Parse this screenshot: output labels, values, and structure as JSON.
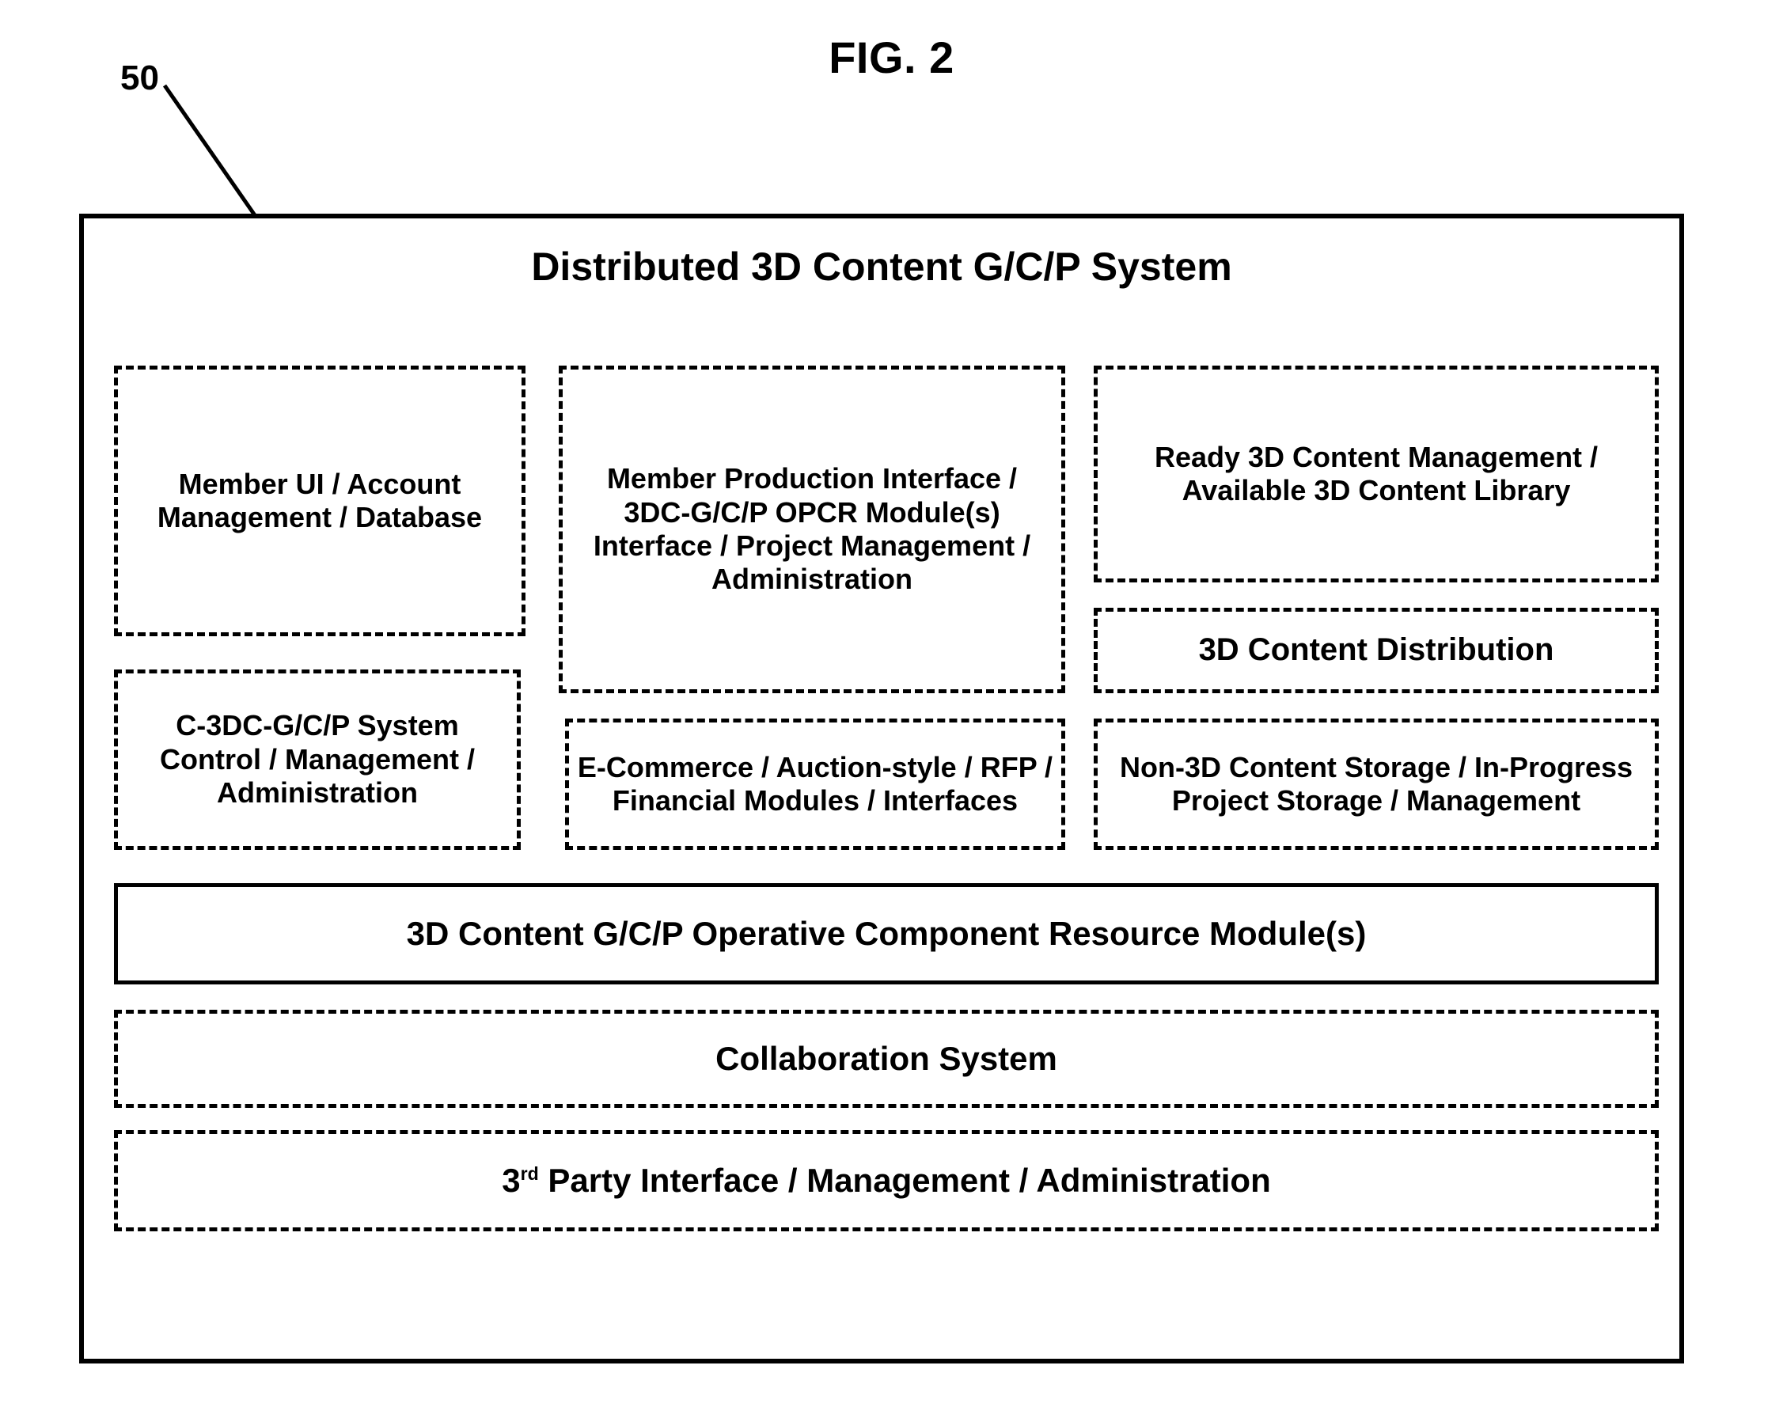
{
  "figure": {
    "label": "FIG. 2",
    "reference_numeral": "50"
  },
  "system": {
    "title": "Distributed 3D Content G/C/P System",
    "border_color": "#000000",
    "background_color": "#ffffff",
    "modules": {
      "member_ui": "Member UI / Account Management / Database",
      "system_control": "C-3DC-G/C/P System Control / Management / Administration",
      "member_production": "Member Production Interface / 3DC-G/C/P OPCR Module(s) Interface / Project Management / Administration",
      "ecommerce": "E-Commerce / Auction-style / RFP / Financial Modules / Interfaces",
      "ready_3d_content": "Ready 3D Content Management / Available 3D Content Library",
      "content_distribution": "3D Content Distribution",
      "non_3d_storage": "Non-3D Content Storage / In-Progress Project Storage / Management",
      "opcr_modules": "3D Content G/C/P Operative Component Resource Module(s)",
      "collaboration": "Collaboration System",
      "third_party_prefix": "3",
      "third_party_ordinal": "rd",
      "third_party_rest": " Party Interface / Management / Administration"
    }
  }
}
